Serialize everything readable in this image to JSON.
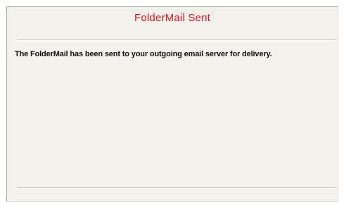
{
  "dialog": {
    "title": "FolderMail Sent",
    "title_color": "#e8141b",
    "message": "The FolderMail has been sent to your outgoing email server for delivery."
  }
}
